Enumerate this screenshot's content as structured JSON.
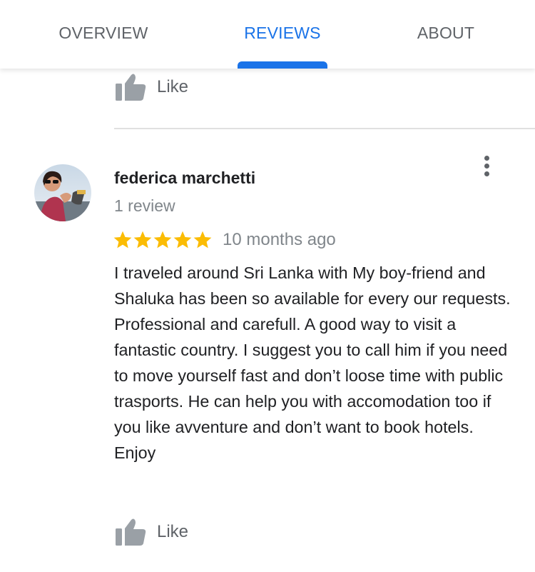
{
  "tabs": {
    "overview": "OVERVIEW",
    "reviews": "REVIEWS",
    "about": "ABOUT",
    "active": "reviews"
  },
  "previous_review": {
    "like_label": "Like"
  },
  "review": {
    "author": "federica marchetti",
    "review_count": "1 review",
    "rating": 5,
    "max_rating": 5,
    "time": "10 months ago",
    "text": "I traveled around Sri Lanka with My boy-friend and Shaluka has been so available for every our requests. Professional and carefull. A good way to visit a fantastic country. I suggest you to call him if you need to move yourself fast and don’t loose time with public trasports. He can help you with accomodation too if you like avventure and don’t want to book hotels. Enjoy",
    "like_label": "Like"
  },
  "colors": {
    "accent": "#1a73e8",
    "star": "#fbbc04",
    "muted": "#80868b",
    "icon_gray": "#9aa0a6"
  },
  "icons": {
    "like": "thumb-up-icon",
    "menu": "more-vert-icon",
    "star": "star-icon"
  }
}
